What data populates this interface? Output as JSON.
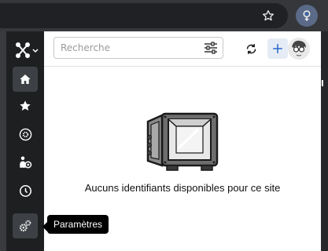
{
  "browser": {
    "bookmark_icon": "star-outline-icon",
    "extension_icon": "passbolt-extension-icon"
  },
  "sidebar": {
    "logo_icon": "app-logo-icon",
    "items": [
      {
        "name": "home",
        "icon": "home-icon",
        "active": true
      },
      {
        "name": "favorites",
        "icon": "star-icon"
      },
      {
        "name": "settings-circle",
        "icon": "gear-circle-icon"
      },
      {
        "name": "shared",
        "icon": "user-gear-icon"
      },
      {
        "name": "recent",
        "icon": "clock-icon"
      },
      {
        "name": "parametres",
        "icon": "gears-icon"
      }
    ]
  },
  "header": {
    "search_placeholder": "Recherche",
    "filter_icon": "sliders-icon",
    "refresh_icon": "refresh-icon",
    "add_icon": "plus-icon"
  },
  "empty_state": {
    "message": "Aucuns identifiants disponibles pour ce site",
    "illustration": "open-safe-illustration"
  },
  "tooltip": {
    "text": "Paramètres"
  },
  "colors": {
    "sidebar_bg": "#1d1f21",
    "sidebar_active": "#3d4044",
    "accent": "#2a6ac9",
    "popup_bg": "#ffffff"
  }
}
